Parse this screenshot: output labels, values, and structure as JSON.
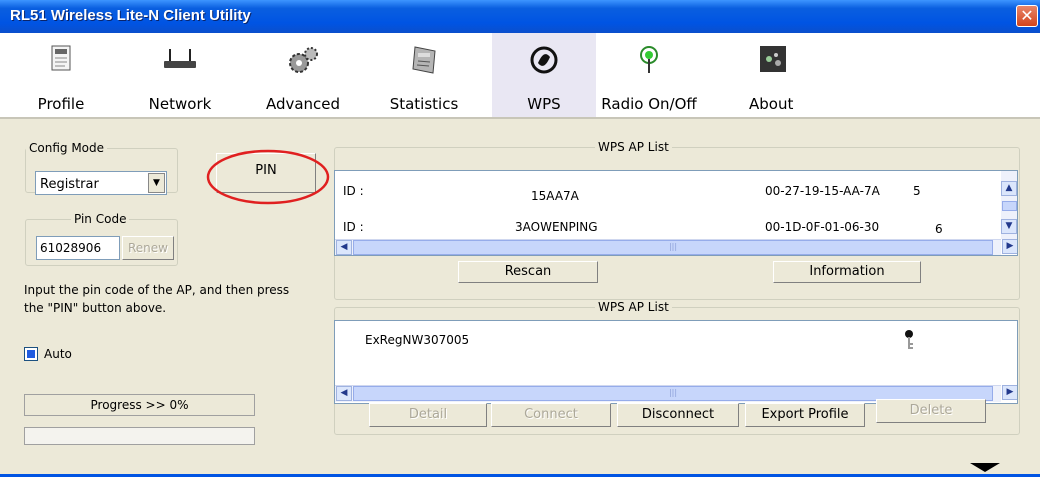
{
  "window": {
    "title": "RL51 Wireless Lite-N Client Utility",
    "close_glyph": "✕"
  },
  "toolbar": {
    "items": [
      {
        "label": "Profile",
        "icon": "profile-icon"
      },
      {
        "label": "Network",
        "icon": "network-icon"
      },
      {
        "label": "Advanced",
        "icon": "advanced-icon"
      },
      {
        "label": "Statistics",
        "icon": "statistics-icon"
      },
      {
        "label": "WPS",
        "icon": "wps-icon",
        "active": true
      },
      {
        "label": "Radio On/Off",
        "icon": "radio-icon"
      },
      {
        "label": "About",
        "icon": "about-icon"
      }
    ]
  },
  "left": {
    "config_mode_legend": "Config Mode",
    "config_mode_value": "Registrar",
    "pin_button": "PIN",
    "pin_code_legend": "Pin Code",
    "pin_code_value": "61028906",
    "renew_button": "Renew",
    "instruction_line1": "Input the pin code of the AP, and then press",
    "instruction_line2": "the \"PIN\" button above.",
    "auto_label": "Auto",
    "auto_checked": true,
    "progress_label": "Progress >> 0%",
    "progress_value": 0
  },
  "ap_list": {
    "legend": "WPS AP List",
    "rows": [
      {
        "id_label": "ID :",
        "ssid": "15AA7A",
        "bssid": "00-27-19-15-AA-7A",
        "channel": "5"
      },
      {
        "id_label": "ID :",
        "ssid": "3AOWENPING",
        "bssid": "00-1D-0F-01-06-30",
        "channel": "6"
      }
    ],
    "rescan_button": "Rescan",
    "information_button": "Information"
  },
  "profile_list": {
    "legend": "WPS AP List",
    "entries": [
      {
        "name": "ExRegNW307005"
      }
    ],
    "detail_button": "Detail",
    "connect_button": "Connect",
    "disconnect_button": "Disconnect",
    "export_button": "Export Profile",
    "delete_button": "Delete"
  },
  "colors": {
    "titlebar": "#0054e3",
    "annotation_circle": "#e02020",
    "panel_bg": "#ece9d8"
  }
}
